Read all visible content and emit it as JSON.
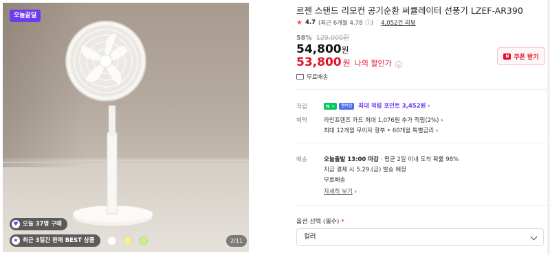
{
  "gallery": {
    "tag_today": "오늘끝딜",
    "badge_purchases": "오늘 37명 구매",
    "badge_best": "최근 3일간 판매 BEST 상품",
    "counter": "2/11",
    "color_dots": [
      "#ffffff",
      "#f5f09a",
      "#c9ef8a"
    ]
  },
  "product": {
    "title": "르젠 스탠드 리모컨 공기순환 써큘레이터 선풍기 LZEF-AR390",
    "rating": "4.7",
    "rating_recent": "(최근 6개월 4.78",
    "rating_info": "ⓘ)",
    "reviews": "4,052건 리뷰",
    "discount_rate": "58%",
    "original_price": "129,000원",
    "price": "54,800",
    "price_unit": "원",
    "sale_price": "53,800",
    "sale_unit": "원",
    "sale_label": "나의 할인가",
    "coupon_button": "쿠폰 받기",
    "shipping_summary": "무료배송"
  },
  "details": {
    "points_label": "적립",
    "points_badge": "N +",
    "points_badge2": "멤버십",
    "points_text": "최대 적립 포인트 3,452원",
    "benefits_label": "혜택",
    "benefit1": "라인프렌즈 카드 최대 1,076원 추가 적립(2%)",
    "benefit2": "최대 12개월 무이자 할부 • 60개월 특별금리",
    "delivery_label": "배송",
    "delivery_bold": "오늘출발 13:00 마감",
    "delivery_rest": " · 평균 2일 이내 도착 확률 98%",
    "delivery_line2": "지금 결제 시 5.29.(금) 발송 예정",
    "delivery_line3": "무료배송",
    "delivery_more": "자세히 보기"
  },
  "options": {
    "label": "옵션 선택 (필수)",
    "required_mark": "*",
    "select_value": "컬러"
  }
}
